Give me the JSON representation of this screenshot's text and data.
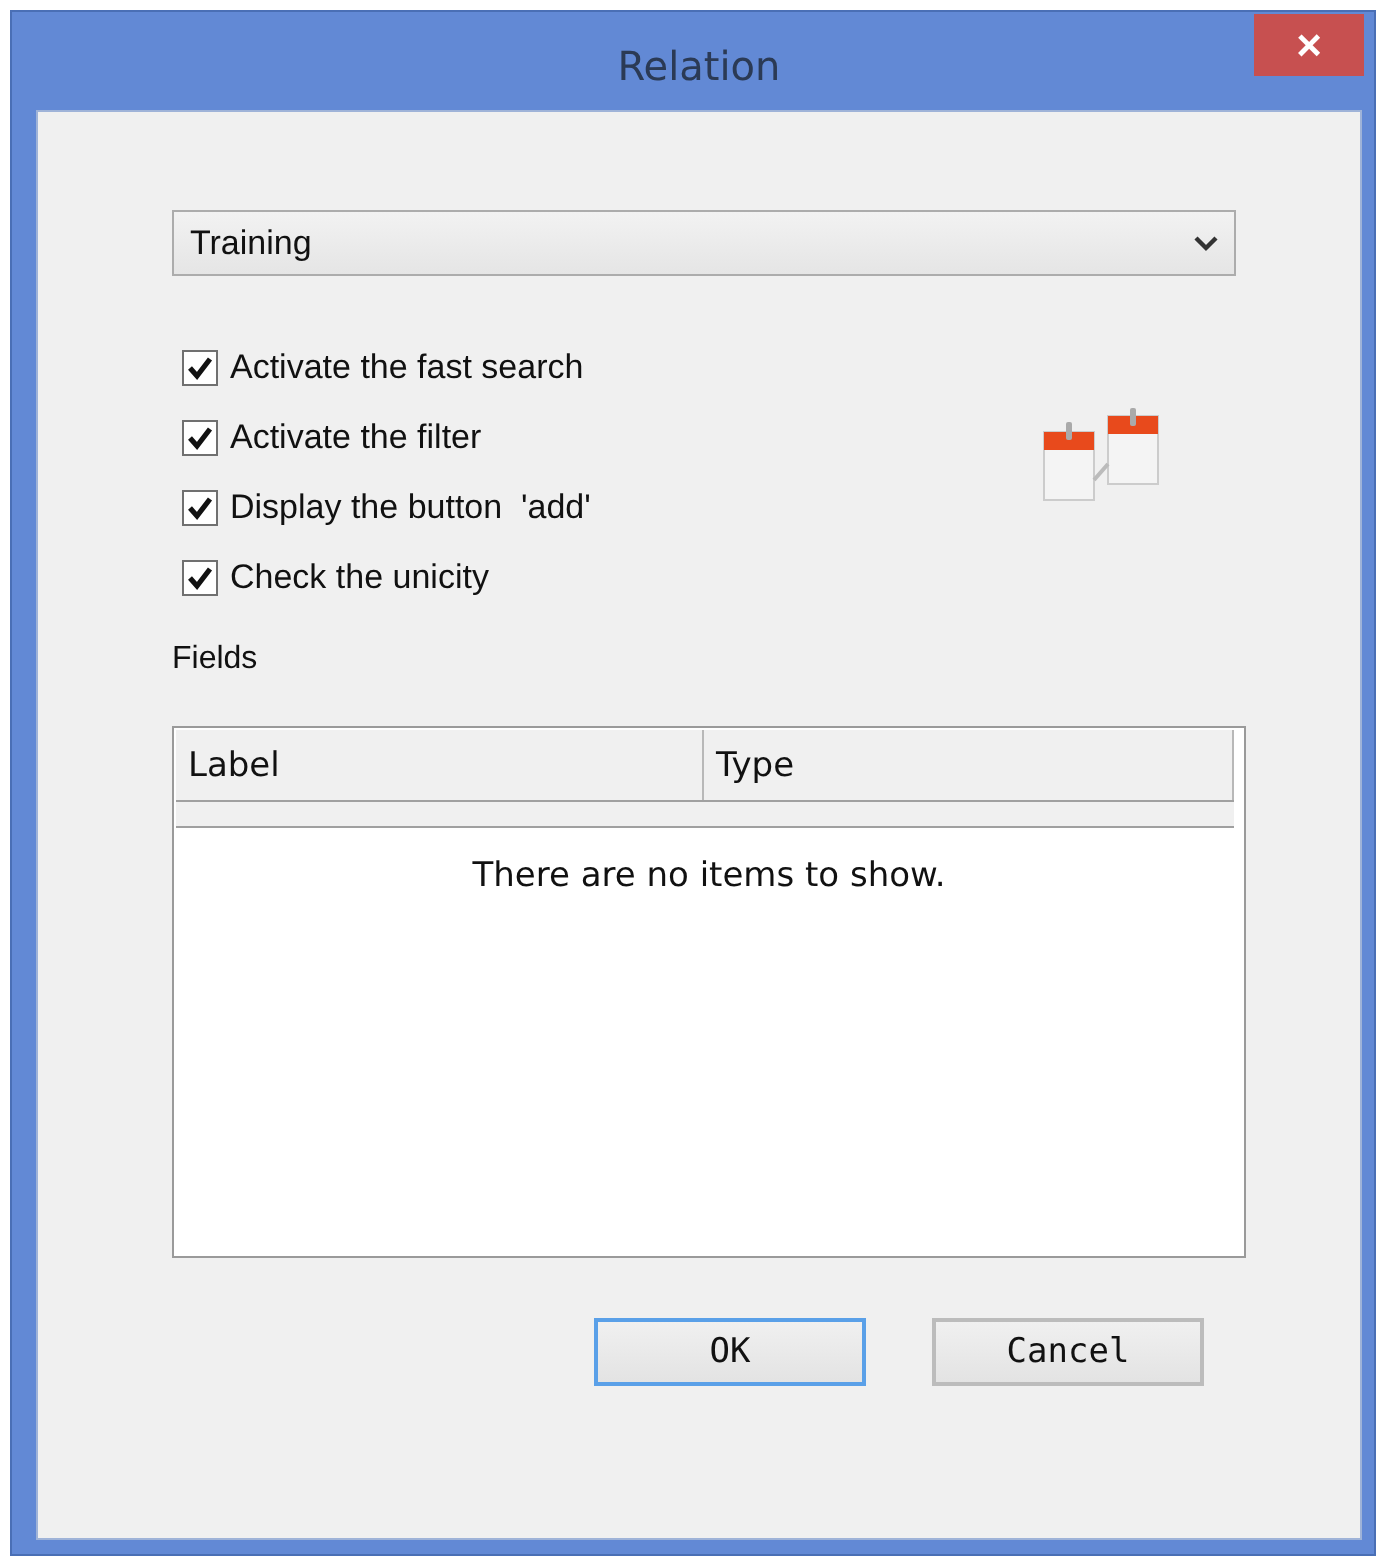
{
  "window": {
    "title": "Relation",
    "close": "×"
  },
  "dropdown": {
    "value": "Training"
  },
  "options": [
    {
      "label": "Activate the fast search",
      "checked": true
    },
    {
      "label": "Activate the filter",
      "checked": true
    },
    {
      "label": "Display the button  'add'",
      "checked": true
    },
    {
      "label": "Check the unicity",
      "checked": true
    }
  ],
  "fields": {
    "label": "Fields",
    "columns": [
      "Label",
      "Type"
    ],
    "empty_message": "There are no items to show."
  },
  "buttons": [
    {
      "label": "OK",
      "default": true
    },
    {
      "label": "Cancel",
      "default": false
    }
  ]
}
